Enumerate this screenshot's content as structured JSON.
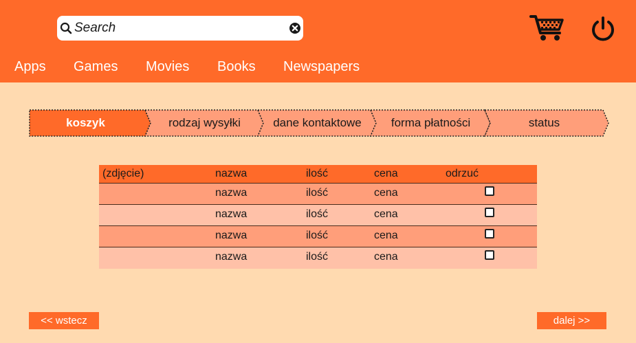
{
  "header": {
    "search": {
      "placeholder": "Search",
      "value": ""
    },
    "icons": {
      "search": "search-icon",
      "clear": "clear-icon",
      "cart": "cart-icon",
      "power": "power-icon"
    }
  },
  "nav": {
    "items": [
      {
        "label": "Apps"
      },
      {
        "label": "Games"
      },
      {
        "label": "Movies"
      },
      {
        "label": "Books"
      },
      {
        "label": "Newspapers"
      }
    ]
  },
  "steps": {
    "items": [
      {
        "label": "koszyk",
        "active": true
      },
      {
        "label": "rodzaj wysyłki",
        "active": false
      },
      {
        "label": "dane kontaktowe",
        "active": false
      },
      {
        "label": "forma płatności",
        "active": false
      },
      {
        "label": "status",
        "active": false
      }
    ]
  },
  "table": {
    "headers": {
      "photo": "(zdjęcie)",
      "name": "nazwa",
      "qty": "ilość",
      "price": "cena",
      "reject": "odrzuć"
    },
    "rows": [
      {
        "photo": "",
        "name": "nazwa",
        "qty": "ilość",
        "price": "cena",
        "checked": false
      },
      {
        "photo": "",
        "name": "nazwa",
        "qty": "ilość",
        "price": "cena",
        "checked": false
      },
      {
        "photo": "",
        "name": "nazwa",
        "qty": "ilość",
        "price": "cena",
        "checked": false
      },
      {
        "photo": "",
        "name": "nazwa",
        "qty": "ilość",
        "price": "cena",
        "checked": false
      }
    ]
  },
  "buttons": {
    "back": "<< wstecz",
    "next": "dalej >>"
  },
  "colors": {
    "accent": "#ff6a29",
    "background": "#ffdab0",
    "step_inactive": "#ff9e7a",
    "row_odd": "#ff9e7a",
    "row_even": "#ffc1a8"
  }
}
